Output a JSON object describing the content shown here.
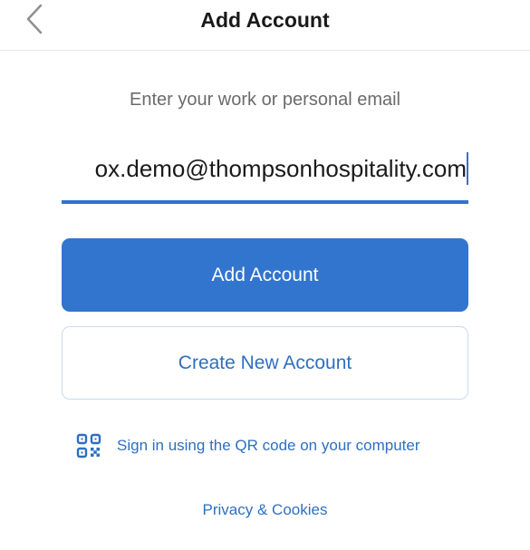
{
  "header": {
    "title": "Add Account",
    "back_icon": "chevron-left-icon"
  },
  "prompt": {
    "text": "Enter your work or personal email"
  },
  "email": {
    "value": "ox.demo@thompsonhospitality.com"
  },
  "buttons": {
    "add_account": "Add Account",
    "create_new_account": "Create New Account"
  },
  "qr_link": {
    "icon": "qr-code-icon",
    "label": "Sign in using the QR code on your computer"
  },
  "privacy": {
    "label": "Privacy & Cookies"
  },
  "colors": {
    "accent": "#3275ce",
    "link": "#2f6fbf",
    "title": "#1a1a1a",
    "muted": "#6b6b6b"
  }
}
